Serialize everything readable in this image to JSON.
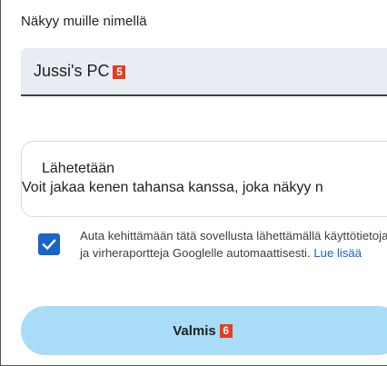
{
  "name_section": {
    "label": "Näkyy muille nimellä",
    "value": "Jussi's PC",
    "badge": "5"
  },
  "share": {
    "title": "Lähetetään",
    "description": "Voit jakaa kenen tahansa kanssa, joka näkyy n"
  },
  "consent": {
    "checked": true,
    "text": "Auta kehittämään tätä sovellusta lähettämällä käyttötietoja ja virheraportteja Googlelle automaattisesti.",
    "link": "Lue lisää"
  },
  "done_button": {
    "label": "Valmis",
    "badge": "6"
  },
  "colors": {
    "accent": "#1a63c9",
    "button_bg": "#a9dcf6",
    "field_bg": "#e8edf4",
    "badge": "#e63d1c"
  }
}
